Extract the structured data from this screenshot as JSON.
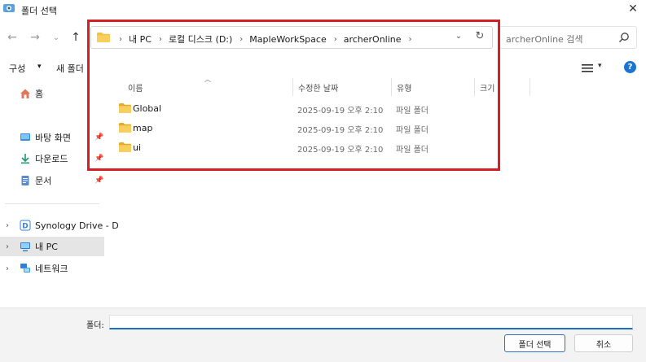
{
  "window": {
    "title": "폴더 선택"
  },
  "address_bar": {
    "breadcrumbs": [
      "내 PC",
      "로컬 디스크 (D:)",
      "MapleWorkSpace",
      "archerOnline"
    ],
    "separator": "›"
  },
  "search": {
    "placeholder": "archerOnline 검색"
  },
  "toolbar": {
    "organize_label": "구성",
    "new_folder_label": "새 폴더"
  },
  "sidebar": {
    "home": "홈",
    "quick_access": [
      {
        "label": "바탕 화면",
        "icon": "desktop-icon",
        "pinned": true
      },
      {
        "label": "다운로드",
        "icon": "download-icon",
        "pinned": true
      },
      {
        "label": "문서",
        "icon": "documents-icon",
        "pinned": true
      }
    ],
    "tree": [
      {
        "label": "Synology Drive - D",
        "icon": "synology-drive-icon",
        "selected": false
      },
      {
        "label": "내 PC",
        "icon": "pc-icon",
        "selected": true
      },
      {
        "label": "네트워크",
        "icon": "network-icon",
        "selected": false
      }
    ]
  },
  "file_list": {
    "columns": [
      "이름",
      "수정한 날짜",
      "유형",
      "크기"
    ],
    "sort_column": "이름",
    "rows": [
      {
        "name": "Global",
        "modified": "2025-09-19 오후 2:10",
        "type": "파일 폴더",
        "size": ""
      },
      {
        "name": "map",
        "modified": "2025-09-19 오후 2:10",
        "type": "파일 폴더",
        "size": ""
      },
      {
        "name": "ui",
        "modified": "2025-09-19 오후 2:10",
        "type": "파일 폴더",
        "size": ""
      }
    ]
  },
  "footer": {
    "folder_label": "폴더:",
    "folder_value": "",
    "select_button": "폴더 선택",
    "cancel_button": "취소"
  },
  "colors": {
    "highlight": "#d41f25",
    "folder": "#f4c044",
    "accent": "#1b74d3",
    "selected_bg": "#e5e5e5"
  }
}
